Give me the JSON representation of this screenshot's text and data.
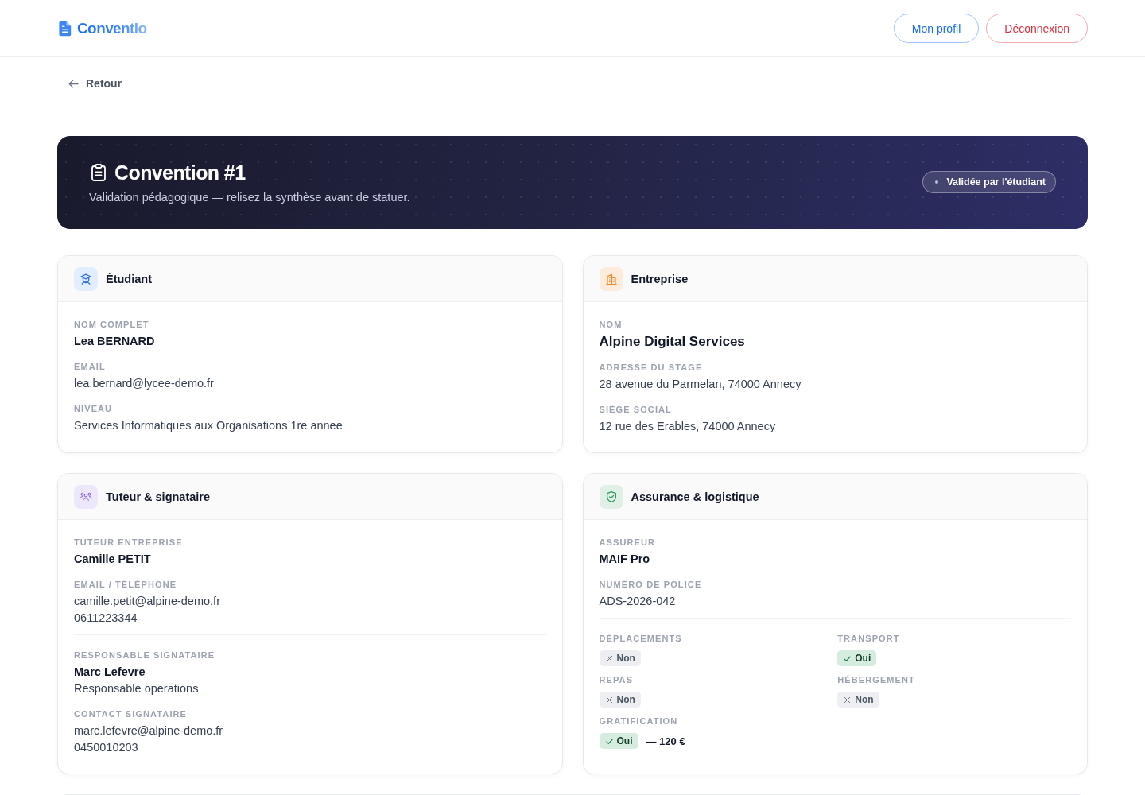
{
  "header": {
    "logo": "Conventio",
    "buttons": [
      {
        "label": "Mon profil",
        "kind": "profile"
      },
      {
        "label": "Déconnexion",
        "kind": "logout"
      }
    ]
  },
  "back_link": {
    "label": "Retour"
  },
  "banner": {
    "title": "Convention #1",
    "subtitle": "Validation pédagogique — relisez la synthèse avant de statuer.",
    "status": "Validée par l'étudiant"
  },
  "cards": [
    {
      "title": "Étudiant",
      "kind": "student",
      "sections": [
        {
          "kind": "fields",
          "fields": [
            {
              "label": "NOM COMPLET",
              "lines": [
                {
                  "text": "Lea BERNARD",
                  "kind": "name"
                }
              ]
            },
            {
              "label": "EMAIL",
              "lines": [
                {
                  "text": "lea.bernard@lycee-demo.fr",
                  "kind": "text"
                }
              ]
            },
            {
              "label": "NIVEAU",
              "lines": [
                {
                  "text": "Services Informatiques aux Organisations 1re annee",
                  "kind": "text"
                }
              ]
            }
          ]
        }
      ]
    },
    {
      "title": "Entreprise",
      "kind": "company",
      "sections": [
        {
          "kind": "fields",
          "fields": [
            {
              "label": "NOM",
              "lines": [
                {
                  "text": "Alpine Digital Services",
                  "kind": "title"
                }
              ]
            },
            {
              "label": "ADRESSE DU STAGE",
              "lines": [
                {
                  "text": "28 avenue du Parmelan, 74000 Annecy",
                  "kind": "text"
                }
              ]
            },
            {
              "label": "SIÈGE SOCIAL",
              "lines": [
                {
                  "text": "12 rue des Erables, 74000 Annecy",
                  "kind": "text"
                }
              ]
            }
          ]
        }
      ]
    },
    {
      "title": "Tuteur & signataire",
      "kind": "people",
      "sections": [
        {
          "kind": "fields",
          "fields": [
            {
              "label": "TUTEUR ENTREPRISE",
              "lines": [
                {
                  "text": "Camille PETIT",
                  "kind": "name"
                }
              ]
            },
            {
              "label": "EMAIL / TÉLÉPHONE",
              "lines": [
                {
                  "text": "camille.petit@alpine-demo.fr",
                  "kind": "text"
                },
                {
                  "text": "0611223344",
                  "kind": "text"
                }
              ]
            }
          ]
        },
        {
          "kind": "fields",
          "fields": [
            {
              "label": "RESPONSABLE SIGNATAIRE",
              "lines": [
                {
                  "text": "Marc Lefevre",
                  "kind": "name"
                },
                {
                  "text": "Responsable operations",
                  "kind": "text"
                }
              ]
            },
            {
              "label": "CONTACT SIGNATAIRE",
              "lines": [
                {
                  "text": "marc.lefevre@alpine-demo.fr",
                  "kind": "text"
                },
                {
                  "text": "0450010203",
                  "kind": "text"
                }
              ]
            }
          ]
        }
      ]
    },
    {
      "title": "Assurance & logistique",
      "kind": "insurance",
      "sections": [
        {
          "kind": "fields",
          "fields": [
            {
              "label": "ASSUREUR",
              "lines": [
                {
                  "text": "MAIF Pro",
                  "kind": "name"
                }
              ]
            },
            {
              "label": "NUMÉRO DE POLICE",
              "lines": [
                {
                  "text": "ADS-2026-042",
                  "kind": "text"
                }
              ]
            }
          ]
        },
        {
          "kind": "flags",
          "flags": [
            {
              "label": "DÉPLACEMENTS",
              "value": "Non",
              "on": false
            },
            {
              "label": "TRANSPORT",
              "value": "Oui",
              "on": true
            },
            {
              "label": "REPAS",
              "value": "Non",
              "on": false
            },
            {
              "label": "HÉBERGEMENT",
              "value": "Non",
              "on": false
            },
            {
              "label": "GRATIFICATION",
              "value": "Oui",
              "on": true,
              "amount": "— 120 €"
            }
          ]
        }
      ]
    }
  ]
}
